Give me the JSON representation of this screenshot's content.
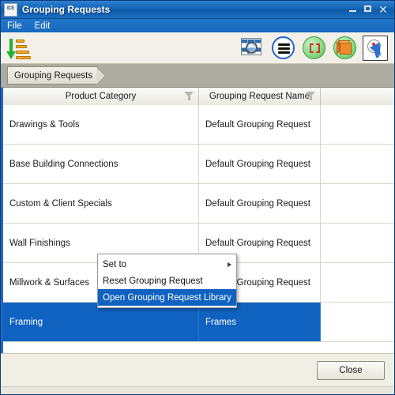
{
  "window": {
    "app_icon_label": "ICE",
    "title": "Grouping Requests",
    "minimize_label": "–",
    "maximize_label": "",
    "close_label": "✕"
  },
  "menubar": {
    "items": [
      {
        "label": "File"
      },
      {
        "label": "Edit"
      }
    ]
  },
  "toolbar": {
    "left_buttons": [
      {
        "name": "sort-descending-icon",
        "tooltip": "Sort"
      }
    ],
    "right_buttons": [
      {
        "name": "table-search-icon",
        "tooltip": "Find in Table"
      },
      {
        "name": "menu-circle-icon",
        "tooltip": "Menu"
      },
      {
        "name": "select-region-icon",
        "tooltip": "Select Region"
      },
      {
        "name": "model-box-icon",
        "tooltip": "Model Object"
      },
      {
        "name": "pick-tool-icon",
        "tooltip": "Pick Tool",
        "pressed": true
      }
    ]
  },
  "breadcrumb": {
    "items": [
      {
        "label": "Grouping Requests"
      }
    ]
  },
  "table": {
    "columns": [
      {
        "key": "product_category",
        "label": "Product Category",
        "filterable": true
      },
      {
        "key": "grouping_request_name",
        "label": "Grouping Request Name",
        "filterable": true
      },
      {
        "key": "extra",
        "label": "",
        "filterable": false
      }
    ],
    "rows": [
      {
        "product_category": "Drawings & Tools",
        "grouping_request_name": "Default Grouping Request",
        "extra": "",
        "selected": false
      },
      {
        "product_category": "Base Building Connections",
        "grouping_request_name": "Default Grouping Request",
        "extra": "",
        "selected": false
      },
      {
        "product_category": "Custom & Client Specials",
        "grouping_request_name": "Default Grouping Request",
        "extra": "",
        "selected": false
      },
      {
        "product_category": "Wall Finishings",
        "grouping_request_name": "Default Grouping Request",
        "extra": "",
        "selected": false
      },
      {
        "product_category": "Millwork & Surfaces",
        "grouping_request_name": "Default Grouping Request",
        "extra": "",
        "selected": false
      },
      {
        "product_category": "Framing",
        "grouping_request_name": "Frames",
        "extra": "",
        "selected": true
      }
    ]
  },
  "context_menu": {
    "items": [
      {
        "label": "Set to",
        "has_submenu": true,
        "highlighted": false
      },
      {
        "label": "Reset Grouping Request",
        "has_submenu": false,
        "highlighted": false
      },
      {
        "label": "Open Grouping Request Library",
        "has_submenu": false,
        "highlighted": true
      }
    ]
  },
  "footer": {
    "close_button_label": "Close"
  },
  "colors": {
    "titlebar_blue": "#1464b4",
    "selection_blue": "#0f62c0",
    "accent_border_blue": "#1f66c8",
    "chrome_beige": "#f0efe6",
    "breadcrumb_strip": "#aeaca0"
  }
}
